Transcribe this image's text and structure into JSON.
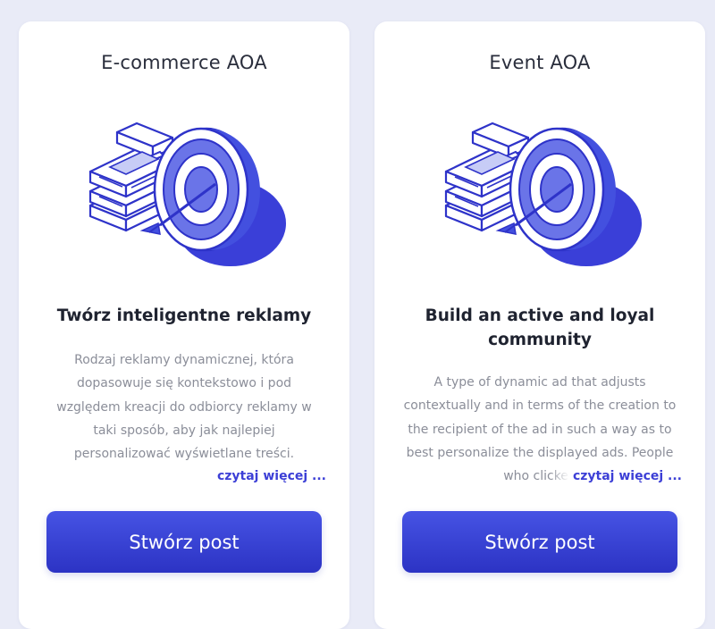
{
  "cards": [
    {
      "title": "E-commerce AOA",
      "illustration_icon": "money-target-icon",
      "headline": "Twórz inteligentne reklamy",
      "description": "Rodzaj reklamy dynamicznej, która dopasowuje się kontekstowo i pod względem kreacji do odbiorcy reklamy w taki sposób, aby jak najlepiej personalizować wyświetlane treści. Osobom, które kliknęły",
      "read_more": "czytaj więcej ...",
      "button": "Stwórz post"
    },
    {
      "title": "Event AOA",
      "illustration_icon": "money-target-icon",
      "headline": "Build an active and loyal community",
      "description": "A type of dynamic ad that adjusts contextually and in terms of the creation to the recipient of the ad in such a way as to best personalize the displayed ads. People who clicked",
      "read_more": "czytaj więcej ...",
      "button": "Stwórz post"
    }
  ],
  "colors": {
    "accent": "#3c3fd6",
    "button_top": "#4653e4",
    "button_bottom": "#2c33c4",
    "page_background": "#e9ebf7"
  }
}
